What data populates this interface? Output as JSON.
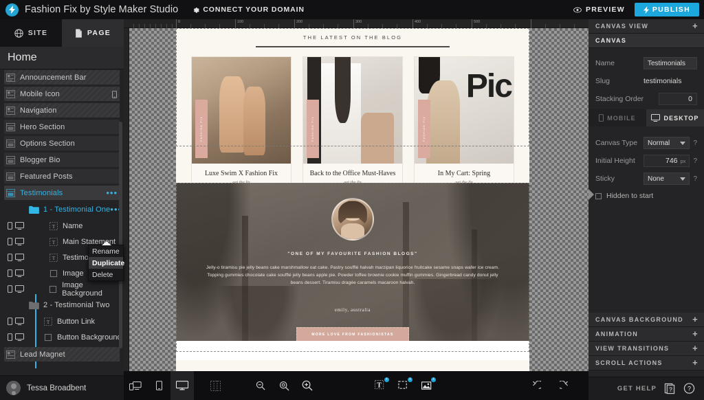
{
  "topbar": {
    "logo_icon": "lightning-logo-icon",
    "app_title": "Fashion Fix by Style Maker Studio",
    "connect_domain": "CONNECT YOUR DOMAIN",
    "gear_icon": "gear-icon",
    "preview": "PREVIEW",
    "preview_icon": "eye-icon",
    "publish": "PUBLISH",
    "publish_icon": "lightning-icon"
  },
  "left_panel": {
    "tabs": [
      {
        "label": "SITE",
        "icon": "globe-icon",
        "active": false
      },
      {
        "label": "PAGE",
        "icon": "page-icon",
        "active": true
      }
    ],
    "page_title": "Home",
    "layers": [
      {
        "label": "Announcement Bar",
        "icon": "canvas-striped-icon",
        "style": "striped",
        "selected": false
      },
      {
        "label": "Mobile Icon",
        "icon": "canvas-striped-icon",
        "style": "striped",
        "selected": false,
        "badge_icon": "mobile-icon"
      },
      {
        "label": "Navigation",
        "icon": "canvas-striped-icon",
        "style": "striped",
        "selected": false
      },
      {
        "label": "Hero Section",
        "icon": "canvas-icon",
        "style": "plain",
        "selected": false
      },
      {
        "label": "Options Section",
        "icon": "canvas-icon",
        "style": "plain",
        "selected": false
      },
      {
        "label": "Blogger Bio",
        "icon": "canvas-icon",
        "style": "plain",
        "selected": false
      },
      {
        "label": "Featured Posts",
        "icon": "canvas-icon",
        "style": "plain",
        "selected": false
      },
      {
        "label": "Testimonials",
        "icon": "canvas-icon",
        "style": "selected",
        "selected": true,
        "menu_icon": "more-dots-icon"
      }
    ],
    "group": {
      "label": "1 - Testimonial One",
      "folder_icon": "folder-open-icon",
      "menu_icon": "more-dots-icon",
      "children": [
        {
          "label": "Name",
          "icon": "text-layer-icon"
        },
        {
          "label": "Main Statement",
          "icon": "text-layer-icon"
        },
        {
          "label": "Testimonial",
          "icon": "text-layer-icon"
        },
        {
          "label": "Image",
          "icon": "shape-layer-icon"
        },
        {
          "label": "Image Background",
          "icon": "shape-layer-icon"
        }
      ]
    },
    "group2": {
      "label": "2 - Testimonial Two",
      "folder_icon": "folder-closed-icon"
    },
    "layers_tail": [
      {
        "label": "Button Link",
        "icon": "text-layer-icon",
        "style": "none"
      },
      {
        "label": "Button Background",
        "icon": "shape-layer-icon",
        "style": "none"
      },
      {
        "label": "Lead Magnet",
        "icon": "canvas-striped-icon",
        "style": "striped"
      }
    ],
    "context_menu": [
      {
        "label": "Rename",
        "highlighted": false
      },
      {
        "label": "Duplicate",
        "highlighted": true
      },
      {
        "label": "Delete",
        "highlighted": false
      }
    ],
    "user_name": "Tessa Broadbent",
    "avatar_icon": "user-avatar-icon"
  },
  "canvas": {
    "ruler_ticks": [
      "0",
      "100",
      "200",
      "300",
      "400",
      "500"
    ],
    "blog": {
      "heading": "THE LATEST ON THE BLOG",
      "cards": [
        {
          "title": "Luxe Swim X Fashion Fix",
          "subtitle": "get the fix",
          "ribbon": "FASHION FIX"
        },
        {
          "title": "Back to the Office Must-Haves",
          "subtitle": "get the fix",
          "ribbon": "FASHION FIX"
        },
        {
          "title": "In My Cart: Spring",
          "subtitle": "get the fix",
          "ribbon": "FASHION FIX"
        }
      ]
    },
    "testimonial": {
      "main_statement": "\"ONE OF MY FAVOURITE FASHION BLOGS\"",
      "body": "Jelly-o tiramisu pie jelly beans cake marshmallow oat cake. Pastry soufflé halvah marzipan liquorice fruitcake sesame snaps wafer ice cream. Topping gummies chocolate cake soufflé jelly beans apple pie. Powder toffee brownie cookie muffin gummies. Gingerbread candy donut jelly beans dessert. Tiramisu dragée caramels macaroon halvah.",
      "name": "emily, australia",
      "cta": "MORE LOVE FROM FASHIONISTAS"
    }
  },
  "bottom_toolbar": {
    "buttons": [
      {
        "name": "responsive-view-button",
        "icon": "responsive-icon",
        "active": false
      },
      {
        "name": "mobile-view-button",
        "icon": "mobile-icon",
        "active": false
      },
      {
        "name": "desktop-view-button",
        "icon": "desktop-icon",
        "active": true
      },
      {
        "name": "grid-toggle-button",
        "icon": "grid-icon",
        "active": false
      },
      {
        "name": "zoom-out-button",
        "icon": "zoom-out-icon",
        "active": false
      },
      {
        "name": "zoom-fit-button",
        "icon": "zoom-fit-icon",
        "active": false
      },
      {
        "name": "zoom-in-button",
        "icon": "zoom-in-icon",
        "active": false
      },
      {
        "name": "add-text-button",
        "icon": "add-text-icon",
        "active": false
      },
      {
        "name": "add-shape-button",
        "icon": "add-shape-icon",
        "active": false
      },
      {
        "name": "add-image-button",
        "icon": "add-image-icon",
        "active": false
      }
    ],
    "undo_icon": "undo-icon",
    "redo_icon": "redo-icon"
  },
  "right_panel": {
    "canvas_view_header": "CANVAS VIEW",
    "canvas_header": "CANVAS",
    "name_label": "Name",
    "name_value": "Testimonials",
    "slug_label": "Slug",
    "slug_value": "testimonials",
    "stacking_label": "Stacking Order",
    "stacking_value": "0",
    "device_tabs": [
      {
        "label": "MOBILE",
        "icon": "mobile-icon",
        "active": false
      },
      {
        "label": "DESKTOP",
        "icon": "desktop-icon",
        "active": true
      }
    ],
    "canvas_type_label": "Canvas Type",
    "canvas_type_value": "Normal",
    "initial_height_label": "Initial Height",
    "initial_height_value": "746",
    "initial_height_unit": "px",
    "sticky_label": "Sticky",
    "sticky_value": "None",
    "hidden_label": "Hidden to start",
    "sections": [
      "CANVAS BACKGROUND",
      "ANIMATION",
      "VIEW TRANSITIONS",
      "SCROLL ACTIONS"
    ],
    "get_help": "GET HELP",
    "help_doc_icon": "document-help-icon",
    "help_chat_icon": "chat-help-icon",
    "accent_color": "#1ca8dd"
  }
}
